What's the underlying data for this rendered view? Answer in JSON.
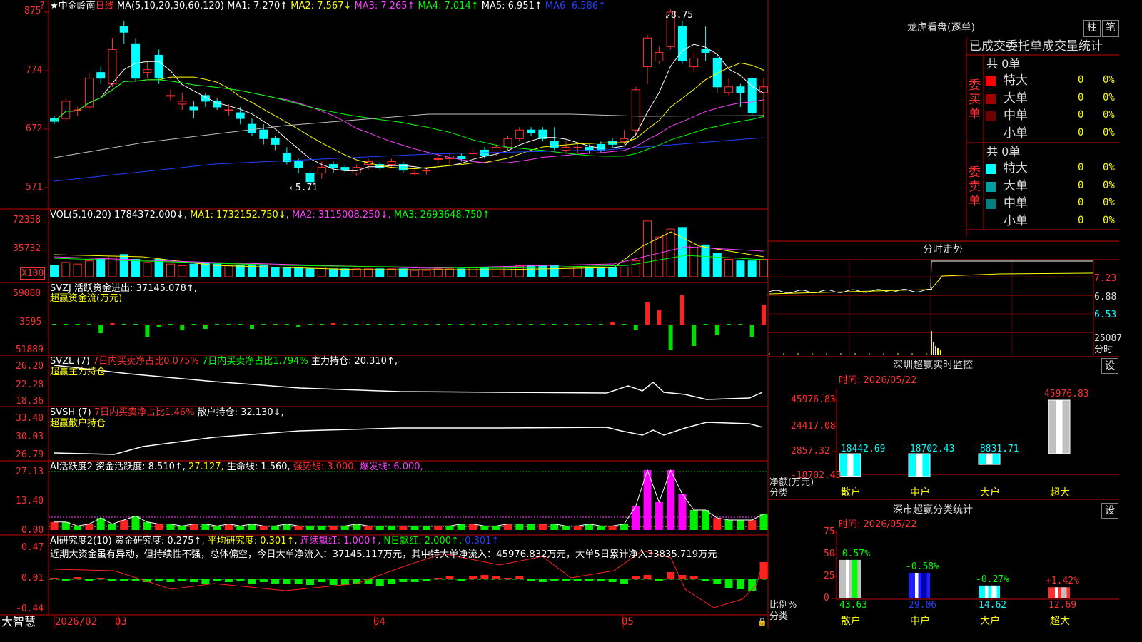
{
  "app": {
    "name": "大智慧",
    "lock": "🔒"
  },
  "main_chart": {
    "star": "★",
    "stock": "中金岭南",
    "period": "日线",
    "ma_label": "MA(5,10,20,30,60,120)",
    "ma1": "MA1: 7.270↑",
    "ma2": "MA2: 7.567↓",
    "ma3": "MA3: 7.265↑",
    "ma4": "MA4: 7.014↑",
    "ma5": "MA5: 6.951↑",
    "ma6": "MA6: 6.586↑",
    "yticks": [
      "875",
      "774",
      "672",
      "571"
    ],
    "high_mark": "8.75",
    "low_mark": "5.71",
    "question": "?"
  },
  "vol": {
    "label": "VOL(5,10,20)",
    "value": "1784372.000↓,",
    "ma1": "MA1: 1732152.750↓,",
    "ma2": "MA2: 3115008.250↓,",
    "ma3": "MA3: 2693648.750↑",
    "yticks": [
      "72358",
      "35732"
    ],
    "unit": "X100"
  },
  "svzj": {
    "label": "SVZJ",
    "name": "活跃资金进出: 37145.078↑,",
    "sub": "超赢资金流(万元)",
    "yticks": [
      "59080",
      "3595",
      "-51889"
    ]
  },
  "svzl": {
    "label": "SVZL (7)",
    "t1": "7日内买卖净占比0.075%",
    "t2": "7日内买卖净占比1.794%",
    "t3": "主力持仓: 20.310↑,",
    "sub": "超赢主力持仓",
    "yticks": [
      "26.20",
      "22.28",
      "18.36"
    ]
  },
  "svsh": {
    "label": "SVSH (7)",
    "t1": "7日内买卖净占比1.46%",
    "t2": "散户持仓: 32.130↓,",
    "sub": "超赢散户持仓",
    "yticks": [
      "33.40",
      "30.03",
      "26.79"
    ]
  },
  "ai1": {
    "label": "AI活跃度2",
    "t1": "资金活跃度: 8.510↑,",
    "t2": "27.127,",
    "t3": "生命线: 1.560,",
    "t4": "强势线: 3.000,",
    "t5": "爆发线: 6.000,",
    "yticks": [
      "27.13",
      "13.40",
      "0.00"
    ]
  },
  "ai2": {
    "label": "AI研究度2(10)",
    "t1": "资金研究度: 0.275↑,",
    "t2": "平均研究度: 0.301↑,",
    "t3": "连续飘红: 1.000↑,",
    "t4": "N日飘红: 2.000↑,",
    "t5": "0.301↑",
    "comment": "近期大资金虽有异动，但持续性不强，总体偏空，今日大单净流入：37145.117万元，其中特大单净流入：45976.832万元，大单5日累计净入33835.719万元",
    "yticks": [
      "0.47",
      "0.01",
      "-0.44"
    ]
  },
  "xaxis": {
    "labels": [
      "2026/02",
      "03",
      "04",
      "05"
    ]
  },
  "dragon": {
    "title": "龙虎看盘(逐单)",
    "btn1": "柱",
    "btn2": "笔",
    "tabs": "已成交委托单成交量统计",
    "buy_label": "委买单",
    "sell_label": "委卖单",
    "buy_total": "共 0单",
    "sell_total": "共 0单",
    "buy_rows": [
      {
        "name": "特大",
        "val": "0",
        "pct": "0%",
        "color": "#ff0000"
      },
      {
        "name": "大单",
        "val": "0",
        "pct": "0%",
        "color": "#a00000"
      },
      {
        "name": "中单",
        "val": "0",
        "pct": "0%",
        "color": "#700000"
      },
      {
        "name": "小单",
        "val": "0",
        "pct": "0%",
        "color": ""
      }
    ],
    "sell_rows": [
      {
        "name": "特大",
        "val": "0",
        "pct": "0%",
        "color": "#00ffff"
      },
      {
        "name": "大单",
        "val": "0",
        "pct": "0%",
        "color": "#00a0a0"
      },
      {
        "name": "中单",
        "val": "0",
        "pct": "0%",
        "color": "#008080"
      },
      {
        "name": "小单",
        "val": "0",
        "pct": "0%",
        "color": ""
      }
    ]
  },
  "intraday": {
    "title": "分时走势",
    "yticks": [
      "7.23",
      "6.88",
      "6.53"
    ],
    "vol_top": "25087",
    "vol_unit": "分时"
  },
  "sz_monitor": {
    "title": "深圳超赢实时监控",
    "btn": "设",
    "time": "时间: 2026/05/22",
    "yticks": [
      "45976.83",
      "24417.08",
      "2857.32",
      "-18702.43"
    ],
    "ylabel": "净额(万元)",
    "xlabel": "分类",
    "bars": [
      {
        "cat": "散户",
        "value": -18442.69,
        "label": "-18442.69"
      },
      {
        "cat": "中户",
        "value": -18702.43,
        "label": "-18702.43"
      },
      {
        "cat": "大户",
        "value": -8831.71,
        "label": "-8831.71"
      },
      {
        "cat": "超大",
        "value": 45976.83,
        "label": "45976.83"
      }
    ]
  },
  "sz_class": {
    "title": "深市超赢分类统计",
    "btn": "设",
    "time": "时间: 2026/05/22",
    "yticks": [
      "75",
      "50",
      "25",
      "0"
    ],
    "ylabel": "比例%",
    "xlabel": "分类",
    "bars": [
      {
        "cat": "散户",
        "value": 43.63,
        "label": "43.63",
        "chg": "-0.57%",
        "chg_color": "#00ff00"
      },
      {
        "cat": "中户",
        "value": 29.06,
        "label": "29.06",
        "chg": "-0.58%",
        "chg_color": "#00ff00"
      },
      {
        "cat": "大户",
        "value": 14.62,
        "label": "14.62",
        "chg": "-0.27%",
        "chg_color": "#00ff00"
      },
      {
        "cat": "超大",
        "value": 12.69,
        "label": "12.69",
        "chg": "+1.42%",
        "chg_color": "#ff3030"
      }
    ]
  },
  "chart_data": [
    {
      "type": "candlestick",
      "title": "中金岭南 日线",
      "ylim": [
        5.6,
        8.9
      ],
      "candles": [
        [
          6.9,
          6.85,
          6.95,
          6.8
        ],
        [
          6.9,
          7.2,
          7.25,
          6.85
        ],
        [
          7.05,
          7.05,
          7.1,
          6.95
        ],
        [
          7.1,
          7.6,
          7.7,
          7.05
        ],
        [
          7.7,
          7.6,
          7.8,
          7.5
        ],
        [
          7.5,
          8.1,
          8.3,
          7.45
        ],
        [
          8.5,
          8.4,
          8.6,
          8.2
        ],
        [
          8.2,
          7.6,
          8.3,
          7.55
        ],
        [
          7.7,
          7.75,
          7.9,
          7.6
        ],
        [
          8.0,
          7.6,
          8.1,
          7.5
        ],
        [
          7.3,
          7.3,
          7.4,
          7.2
        ],
        [
          7.15,
          7.2,
          7.35,
          7.05
        ],
        [
          7.1,
          7.05,
          7.2,
          6.9
        ],
        [
          7.3,
          7.2,
          7.35,
          7.1
        ],
        [
          7.2,
          7.1,
          7.25,
          7.05
        ],
        [
          7.05,
          7.05,
          7.15,
          6.95
        ],
        [
          7.0,
          6.9,
          7.1,
          6.8
        ],
        [
          6.8,
          6.65,
          6.9,
          6.6
        ],
        [
          6.7,
          6.55,
          6.8,
          6.45
        ],
        [
          6.55,
          6.45,
          6.6,
          6.35
        ],
        [
          6.3,
          6.15,
          6.4,
          6.1
        ],
        [
          6.15,
          6.05,
          6.2,
          5.95
        ],
        [
          5.95,
          5.8,
          6.0,
          5.71
        ],
        [
          5.95,
          6.05,
          6.15,
          5.85
        ],
        [
          6.1,
          6.05,
          6.15,
          5.95
        ],
        [
          6.05,
          6.0,
          6.1,
          5.95
        ],
        [
          5.95,
          6.05,
          6.1,
          5.9
        ],
        [
          6.1,
          6.15,
          6.2,
          6.0
        ],
        [
          6.1,
          6.05,
          6.15,
          6.0
        ],
        [
          6.1,
          6.15,
          6.2,
          6.05
        ],
        [
          6.1,
          6.0,
          6.15,
          5.95
        ],
        [
          5.95,
          5.95,
          6.05,
          5.9
        ],
        [
          6.0,
          6.0,
          6.05,
          5.92
        ],
        [
          6.2,
          6.2,
          6.3,
          6.1
        ],
        [
          6.2,
          6.25,
          6.3,
          6.1
        ],
        [
          6.25,
          6.2,
          6.3,
          6.15
        ],
        [
          6.3,
          6.3,
          6.4,
          6.2
        ],
        [
          6.35,
          6.25,
          6.4,
          6.2
        ],
        [
          6.3,
          6.4,
          6.45,
          6.25
        ],
        [
          6.4,
          6.55,
          6.6,
          6.35
        ],
        [
          6.55,
          6.7,
          6.75,
          6.5
        ],
        [
          6.7,
          6.65,
          6.75,
          6.6
        ],
        [
          6.7,
          6.55,
          6.75,
          6.5
        ],
        [
          6.5,
          6.4,
          6.75,
          6.35
        ],
        [
          6.35,
          6.4,
          6.5,
          6.3
        ],
        [
          6.4,
          6.4,
          6.45,
          6.3
        ],
        [
          6.4,
          6.35,
          6.45,
          6.3
        ],
        [
          6.45,
          6.35,
          6.5,
          6.3
        ],
        [
          6.5,
          6.45,
          6.55,
          6.4
        ],
        [
          6.5,
          6.55,
          6.7,
          6.45
        ],
        [
          6.7,
          7.4,
          7.45,
          6.6
        ],
        [
          7.8,
          8.3,
          8.35,
          7.5
        ],
        [
          7.9,
          8.05,
          8.15,
          7.85
        ],
        [
          8.15,
          8.75,
          8.8,
          8.1
        ],
        [
          8.5,
          7.9,
          8.6,
          7.85
        ],
        [
          7.8,
          7.95,
          8.05,
          7.7
        ],
        [
          8.1,
          8.05,
          8.5,
          7.9
        ],
        [
          7.95,
          7.45,
          8.0,
          7.35
        ],
        [
          7.35,
          7.45,
          7.6,
          7.3
        ],
        [
          7.45,
          7.35,
          7.5,
          7.1
        ],
        [
          7.6,
          7.0,
          7.6,
          6.95
        ],
        [
          7.35,
          7.45,
          7.6,
          6.9
        ]
      ],
      "candle_fields": [
        "open",
        "close",
        "high",
        "low"
      ]
    },
    {
      "type": "bar",
      "title": "VOL(5,10,20)",
      "yticks": [
        72358,
        35732
      ]
    },
    {
      "type": "bar",
      "title": "分时走势",
      "x": [],
      "values": []
    },
    {
      "type": "bar",
      "title": "深圳超赢实时监控",
      "categories": [
        "散户",
        "中户",
        "大户",
        "超大"
      ],
      "values": [
        -18442.69,
        -18702.43,
        -8831.71,
        45976.83
      ],
      "ylabel": "净额(万元)",
      "xlabel": "分类",
      "ylim": [
        -18702.43,
        45976.83
      ]
    },
    {
      "type": "bar",
      "title": "深市超赢分类统计",
      "categories": [
        "散户",
        "中户",
        "大户",
        "超大"
      ],
      "values": [
        43.63,
        29.06,
        14.62,
        12.69
      ],
      "ylabel": "比例%",
      "xlabel": "分类",
      "ylim": [
        0,
        75
      ]
    }
  ]
}
